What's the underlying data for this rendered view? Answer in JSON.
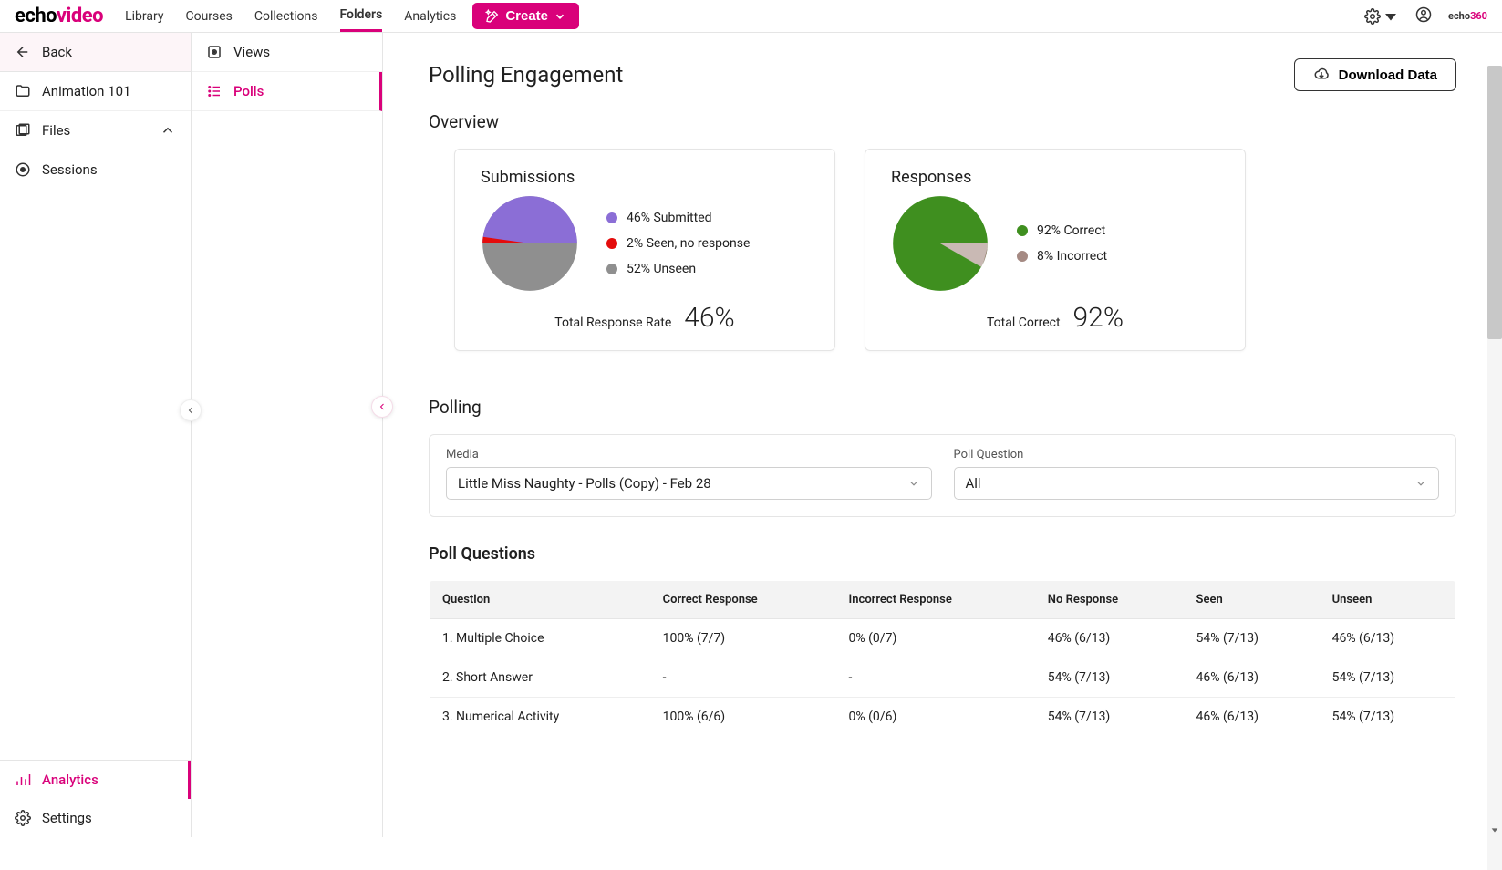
{
  "logo": {
    "a": "echo",
    "b": "video"
  },
  "topnav": {
    "library": "Library",
    "courses": "Courses",
    "collections": "Collections",
    "folders": "Folders",
    "analytics": "Analytics"
  },
  "create_btn": "Create",
  "brand360": {
    "a": "echo",
    "b": "360"
  },
  "sidebar1": {
    "back": "Back",
    "folder": "Animation 101",
    "files": "Files",
    "sessions": "Sessions",
    "analytics": "Analytics",
    "settings": "Settings"
  },
  "sidebar2": {
    "views": "Views",
    "polls": "Polls"
  },
  "page_title": "Polling Engagement",
  "download": "Download Data",
  "overview_heading": "Overview",
  "card1": {
    "title": "Submissions",
    "legend": [
      {
        "label": "46% Submitted",
        "color": "#8b6ed6"
      },
      {
        "label": "2% Seen, no response",
        "color": "#e40c0c"
      },
      {
        "label": "52% Unseen",
        "color": "#8f8f8f"
      }
    ],
    "total_label": "Total Response Rate",
    "total_val": "46%"
  },
  "card2": {
    "title": "Responses",
    "legend": [
      {
        "label": "92% Correct",
        "color": "#3f8f1f"
      },
      {
        "label": "8% Incorrect",
        "color": "#a58a83"
      }
    ],
    "total_label": "Total Correct",
    "total_val": "92%"
  },
  "polling_heading": "Polling",
  "filter": {
    "media_label": "Media",
    "media_value": "Little Miss Naughty - Polls (Copy) - Feb 28",
    "question_label": "Poll Question",
    "question_value": "All"
  },
  "poll_questions_heading": "Poll Questions",
  "table": {
    "headers": [
      "Question",
      "Correct Response",
      "Incorrect Response",
      "No Response",
      "Seen",
      "Unseen"
    ],
    "rows": [
      [
        "1. Multiple Choice",
        "100% (7/7)",
        "0% (0/7)",
        "46% (6/13)",
        "54% (7/13)",
        "46% (6/13)"
      ],
      [
        "2. Short Answer",
        "-",
        "-",
        "54% (7/13)",
        "46% (6/13)",
        "54% (7/13)"
      ],
      [
        "3. Numerical Activity",
        "100% (6/6)",
        "0% (0/6)",
        "54% (7/13)",
        "46% (6/13)",
        "54% (7/13)"
      ]
    ]
  },
  "chart_data": [
    {
      "type": "pie",
      "title": "Submissions",
      "series": [
        {
          "name": "Submitted",
          "value": 46,
          "color": "#8b6ed6"
        },
        {
          "name": "Seen, no response",
          "value": 2,
          "color": "#e40c0c"
        },
        {
          "name": "Unseen",
          "value": 52,
          "color": "#8f8f8f"
        }
      ]
    },
    {
      "type": "pie",
      "title": "Responses",
      "series": [
        {
          "name": "Correct",
          "value": 92,
          "color": "#3f8f1f"
        },
        {
          "name": "Incorrect",
          "value": 8,
          "color": "#a58a83"
        }
      ]
    }
  ]
}
